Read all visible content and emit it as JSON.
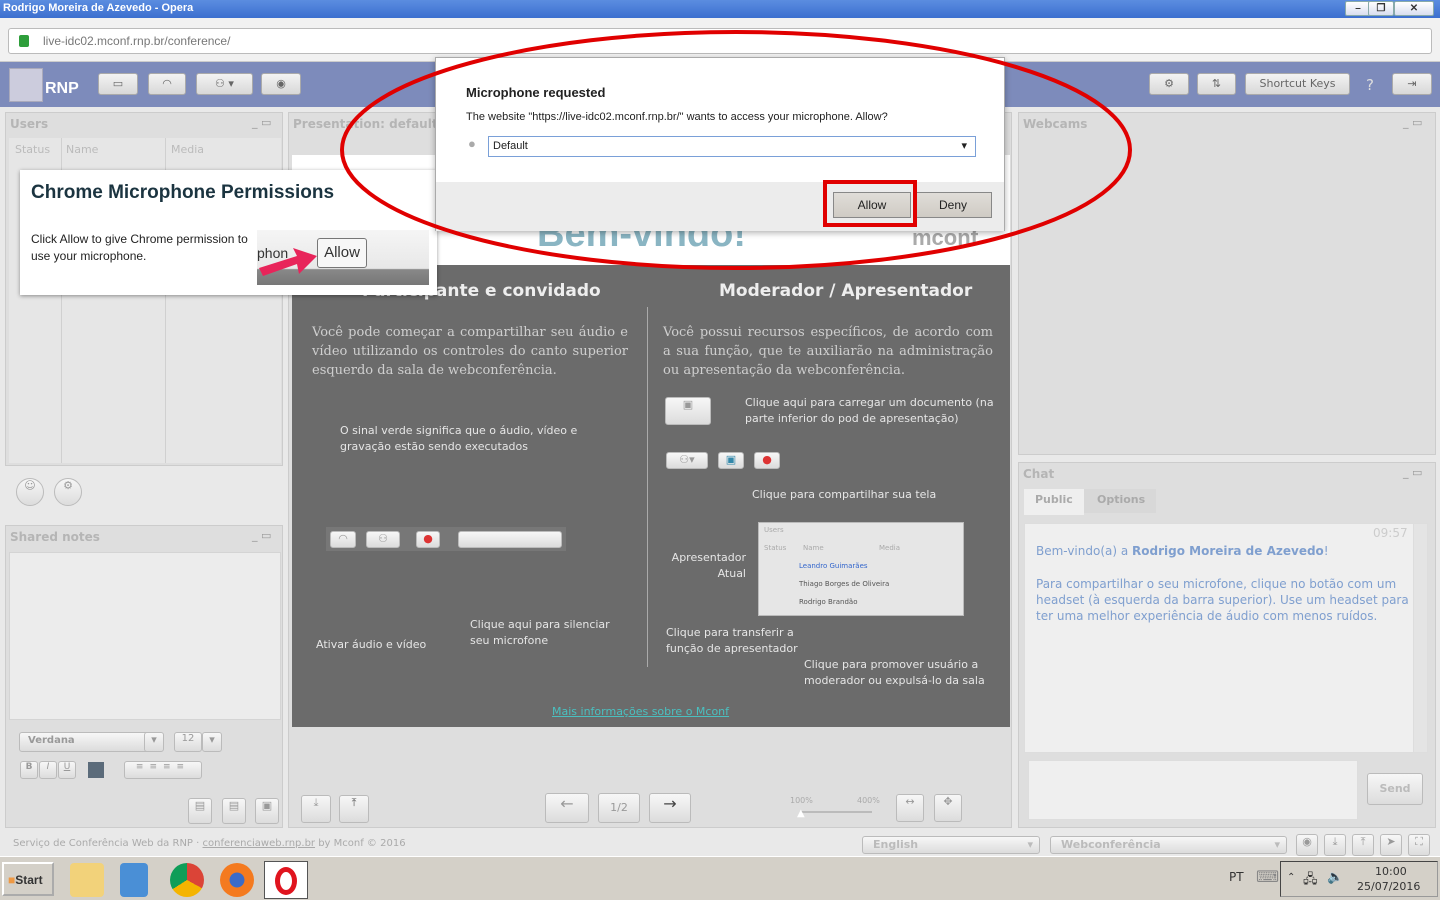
{
  "window": {
    "title": "Rodrigo Moreira de Azevedo - Opera",
    "min": "–",
    "restore": "❐",
    "close": "✕"
  },
  "address": {
    "url": "live-idc02.mconf.rnp.br/conference/"
  },
  "toolbar": {
    "logo": "RNP",
    "shortcut_keys": "Shortcut Keys",
    "help": "?",
    "icons": [
      "screen-share-icon",
      "headset-icon",
      "webcam-icon",
      "record-icon",
      "settings-icon",
      "layout-icon",
      "logout-icon"
    ]
  },
  "users": {
    "title": "Users",
    "columns": [
      "Status",
      "Name",
      "Media"
    ]
  },
  "shared_notes": {
    "title": "Shared notes",
    "font": "Verdana",
    "size": "12",
    "format": [
      "B",
      "I",
      "U"
    ]
  },
  "presentation": {
    "title": "Presentation: default.pdf",
    "page": "1/2",
    "zoom_min": "100%",
    "zoom_max": "400%",
    "slide": {
      "heading": "Bem-vindo!",
      "logo": "mconf",
      "left_title": "Participante e convidado",
      "right_title": "Moderador / Apresentador",
      "left_text": "Você pode começar a compartilhar seu áudio e vídeo utilizando os controles do canto superior esquerdo da sala de webconferência.",
      "right_text": "Você possui recursos específicos, de acordo com a sua função, que te auxiliarão na administração ou apresentação da webconferência.",
      "green_signal": "O sinal verde significa que o áudio, vídeo e gravação estão sendo executados",
      "activate": "Ativar áudio e vídeo",
      "mute": "Clique aqui para silenciar seu microfone",
      "upload": "Clique aqui para carregar um documento (na parte inferior do pod de apresentação)",
      "share_screen": "Clique para compartilhar sua tela",
      "current_presenter": "Apresentador Atual",
      "transfer": "Clique para transferir a função de apresentador",
      "promote": "Clique para promover usuário a moderador ou expulsá-lo da sala",
      "mini_users": {
        "title": "Users",
        "columns": [
          "Status",
          "Name",
          "Media"
        ],
        "rows": [
          "Leandro Guimarães",
          "Thiago Borges de Oliveira",
          "Rodrigo Brandão"
        ]
      },
      "more_info": "Mais informações sobre o Mconf"
    }
  },
  "webcams": {
    "title": "Webcams"
  },
  "chat": {
    "title": "Chat",
    "tabs": [
      "Public",
      "Options"
    ],
    "time": "09:57",
    "welcome_prefix": "Bem-vindo(a) a ",
    "welcome_name": "Rodrigo Moreira de Azevedo",
    "welcome_suffix": "!",
    "message": "Para compartilhar o seu microfone, clique no botão com um headset (à esquerda da barra superior). Use um headset para ter uma melhor experiência de áudio com menos ruídos.",
    "send": "Send"
  },
  "footer": {
    "text_prefix": "Serviço de Conferência Web da RNP · ",
    "link": "conferenciaweb.rnp.br",
    "text_suffix": " by Mconf © 2016",
    "language": "English",
    "room": "Webconferência"
  },
  "chrome_popup": {
    "title": "Chrome Microphone Permissions",
    "text": "Click Allow to give Chrome permission to use your microphone.",
    "snippet": "phon",
    "allow": "Allow"
  },
  "mic_dialog": {
    "title": "Microphone requested",
    "message": "The website \"https://live-idc02.mconf.rnp.br/\" wants to access your microphone. Allow?",
    "device": "Default",
    "allow": "Allow",
    "deny": "Deny"
  },
  "taskbar": {
    "start": "Start",
    "lang": "PT",
    "time": "10:00",
    "date": "25/07/2016",
    "apps": [
      "explorer-icon",
      "media-player-icon",
      "chrome-icon",
      "firefox-icon",
      "opera-icon"
    ]
  },
  "colors": {
    "highlight": "#e00000",
    "toolbar": "#7d8bbb",
    "title_bar": "#3c6fcf",
    "chat_text": "#7f9fcf"
  }
}
